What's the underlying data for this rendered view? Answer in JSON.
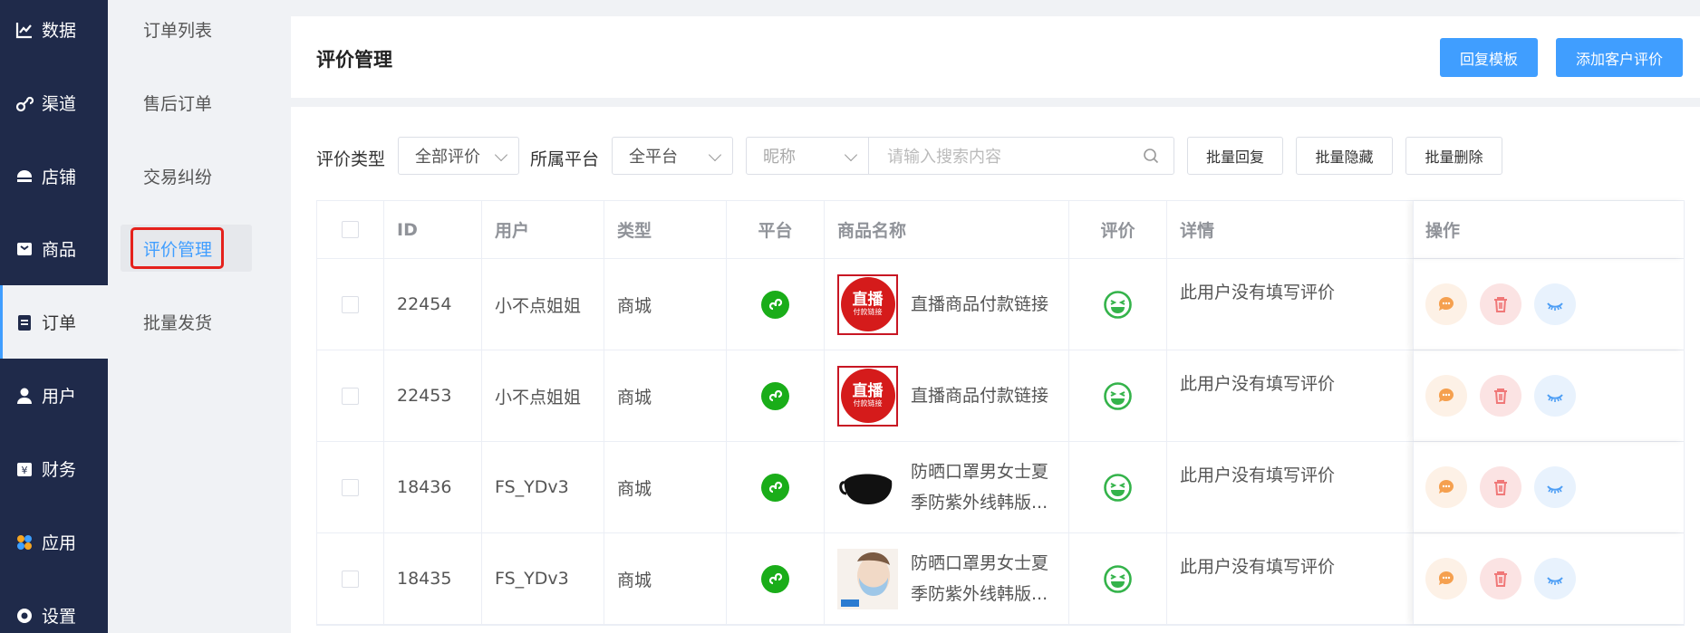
{
  "sidebar": {
    "items": [
      {
        "label": "数据",
        "icon": "chart-line-icon"
      },
      {
        "label": "渠道",
        "icon": "link-icon"
      },
      {
        "label": "店铺",
        "icon": "store-icon"
      },
      {
        "label": "商品",
        "icon": "product-box-icon"
      },
      {
        "label": "订单",
        "icon": "order-clipboard-icon",
        "active": true
      },
      {
        "label": "用户",
        "icon": "user-icon"
      },
      {
        "label": "财务",
        "icon": "finance-yen-icon"
      },
      {
        "label": "应用",
        "icon": "apps-icon"
      },
      {
        "label": "设置",
        "icon": "settings-icon"
      }
    ]
  },
  "subnav": {
    "items": [
      {
        "label": "订单列表"
      },
      {
        "label": "售后订单"
      },
      {
        "label": "交易纠纷"
      },
      {
        "label": "评价管理",
        "active": true
      },
      {
        "label": "批量发货"
      }
    ]
  },
  "header": {
    "title": "评价管理",
    "reply_template_label": "回复模板",
    "add_review_label": "添加客户评价"
  },
  "filters": {
    "type_label": "评价类型",
    "type_value": "全部评价",
    "platform_label": "所属平台",
    "platform_value": "全平台",
    "field_placeholder": "昵称",
    "search_placeholder": "请输入搜索内容",
    "batch_reply": "批量回复",
    "batch_hide": "批量隐藏",
    "batch_delete": "批量删除"
  },
  "table": {
    "columns": [
      "ID",
      "用户",
      "类型",
      "平台",
      "商品名称",
      "评价",
      "详情",
      "操作"
    ],
    "rows": [
      {
        "id": "22454",
        "user": "小不点姐姐",
        "type": "商城",
        "product": "直播商品付款链接",
        "thumb": "live",
        "thumb_big": "直播",
        "thumb_small": "付款链接",
        "detail": "此用户没有填写评价"
      },
      {
        "id": "22453",
        "user": "小不点姐姐",
        "type": "商城",
        "product": "直播商品付款链接",
        "thumb": "live",
        "thumb_big": "直播",
        "thumb_small": "付款链接",
        "detail": "此用户没有填写评价"
      },
      {
        "id": "18436",
        "user": "FS_YDv3",
        "type": "商城",
        "product": "防晒口罩男女士夏季防紫外线韩版...",
        "thumb": "mask",
        "detail": "此用户没有填写评价"
      },
      {
        "id": "18435",
        "user": "FS_YDv3",
        "type": "商城",
        "product": "防晒口罩男女士夏季防紫外线韩版...",
        "thumb": "face",
        "detail": "此用户没有填写评价"
      }
    ]
  },
  "colors": {
    "primary": "#409eff",
    "sidebar_bg": "#1f2a4a",
    "platform_green": "#1aad19",
    "emoji_green": "#34b34a",
    "highlight_red": "#e5211c"
  }
}
